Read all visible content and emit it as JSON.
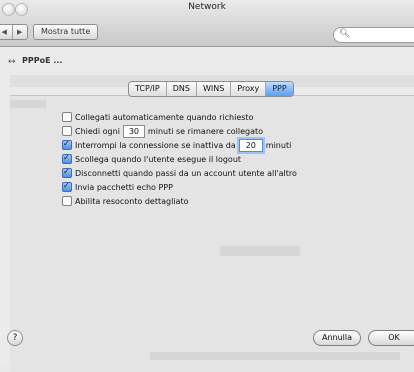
{
  "window": {
    "title": "Network"
  },
  "toolbar": {
    "back_glyph": "◀",
    "forward_glyph": "▶",
    "show_all_label": "Mostra tutte",
    "search_placeholder": ""
  },
  "breadcrumb": {
    "label": "PPPoE ..."
  },
  "tabs": [
    {
      "label": "TCP/IP",
      "active": false
    },
    {
      "label": "DNS",
      "active": false
    },
    {
      "label": "WINS",
      "active": false
    },
    {
      "label": "Proxy",
      "active": false
    },
    {
      "label": "PPP",
      "active": true
    }
  ],
  "options": [
    {
      "label": "Collegati automaticamente quando richiesto",
      "checked": false
    },
    {
      "label_before": "Chiedi ogni",
      "value": "30",
      "label_after": "minuti se rimanere collegato",
      "checked": false
    },
    {
      "label_before": "Interrompi la connessione se inattiva da",
      "value": "20",
      "label_after": "minuti",
      "checked": true
    },
    {
      "label": "Scollega quando l'utente esegue il logout",
      "checked": true
    },
    {
      "label": "Disconnetti quando passi da un account utente all'altro",
      "checked": true
    },
    {
      "label": "Invia pacchetti echo PPP",
      "checked": true
    },
    {
      "label": "Abilita resoconto dettagliato",
      "checked": false
    }
  ],
  "footer": {
    "help_glyph": "?",
    "cancel_label": "Annulla",
    "ok_label": "OK"
  }
}
